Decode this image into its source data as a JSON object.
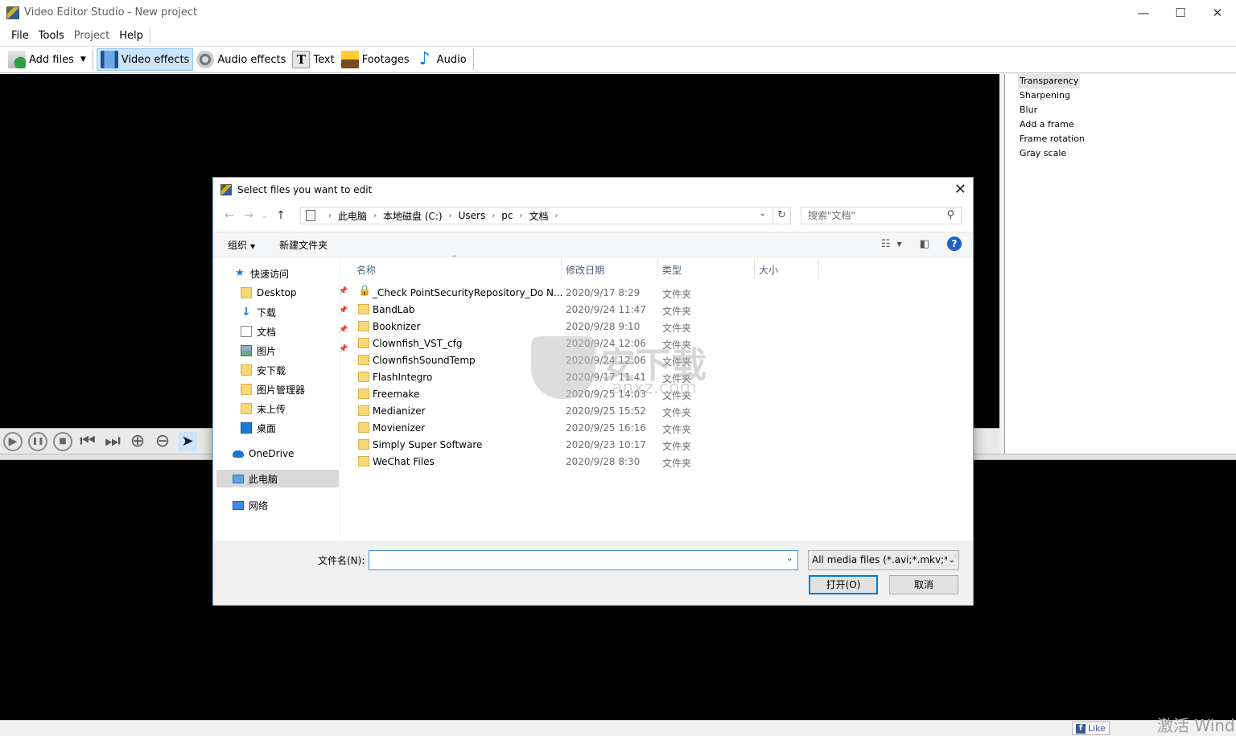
{
  "window": {
    "title": "Video Editor Studio - New project",
    "minimize": "—",
    "maximize": "☐",
    "close": "✕"
  },
  "menu": [
    "File",
    "Tools",
    "Project",
    "Help"
  ],
  "toolbar": {
    "add_files": "Add files",
    "video_effects": "Video effects",
    "audio_effects": "Audio effects",
    "text": "Text",
    "footages": "Footages",
    "audio": "Audio"
  },
  "effects": [
    "Transparency",
    "Sharpening",
    "Blur",
    "Add a frame",
    "Frame rotation",
    "Gray scale"
  ],
  "playback": {
    "play": "▶",
    "pause": "❚❚",
    "stop": "■",
    "prev": "⏮",
    "next": "⏭",
    "zoom_in": "⊕",
    "zoom_out": "⊖",
    "navigate": "➤"
  },
  "status": {
    "like": "Like",
    "activation_watermark": "激活 Wind"
  },
  "dialog": {
    "title": "Select files you want to edit",
    "close": "✕",
    "back": "←",
    "forward": "→",
    "recent": "⌄",
    "up": "↑",
    "breadcrumb": [
      "此电脑",
      "本地磁盘 (C:)",
      "Users",
      "pc",
      "文档"
    ],
    "refresh": "↻",
    "search_placeholder": "搜索\"文档\"",
    "search_icon": "⚲",
    "organize": "组织",
    "new_folder": "新建文件夹",
    "view_icon": "☷",
    "pane_icon": "◧",
    "help": "?",
    "nav": {
      "quick_access": "快速访问",
      "desktop": "Desktop",
      "downloads": "下载",
      "documents": "文档",
      "pictures": "图片",
      "an_xiazai": "安下载",
      "picture_manager": "图片管理器",
      "not_uploaded": "未上传",
      "desktop_cn": "桌面",
      "onedrive": "OneDrive",
      "this_pc": "此电脑",
      "network": "网络"
    },
    "columns": {
      "name": "名称",
      "modified": "修改日期",
      "type": "类型",
      "size": "大小"
    },
    "files": [
      {
        "name": "_Check PointSecurityRepository_Do N...",
        "date": "2020/9/17 8:29",
        "type": "文件夹",
        "locked": true
      },
      {
        "name": "BandLab",
        "date": "2020/9/24 11:47",
        "type": "文件夹"
      },
      {
        "name": "Booknizer",
        "date": "2020/9/28 9:10",
        "type": "文件夹"
      },
      {
        "name": "Clownfish_VST_cfg",
        "date": "2020/9/24 12:06",
        "type": "文件夹"
      },
      {
        "name": "ClownfishSoundTemp",
        "date": "2020/9/24 12:06",
        "type": "文件夹"
      },
      {
        "name": "FlashIntegro",
        "date": "2020/9/17 11:41",
        "type": "文件夹"
      },
      {
        "name": "Freemake",
        "date": "2020/9/25 14:03",
        "type": "文件夹"
      },
      {
        "name": "Medianizer",
        "date": "2020/9/25 15:52",
        "type": "文件夹"
      },
      {
        "name": "Movienizer",
        "date": "2020/9/25 16:16",
        "type": "文件夹"
      },
      {
        "name": "Simply Super Software",
        "date": "2020/9/23 10:17",
        "type": "文件夹"
      },
      {
        "name": "WeChat Files",
        "date": "2020/9/28 8:30",
        "type": "文件夹"
      }
    ],
    "filename_label": "文件名(N):",
    "filename_value": "",
    "filter": "All media files (*.avi;*.mkv;*.f",
    "open": "打开(O)",
    "cancel": "取消"
  },
  "watermark": {
    "logo_text": "安下载",
    "logo_url": "anxz.com"
  }
}
